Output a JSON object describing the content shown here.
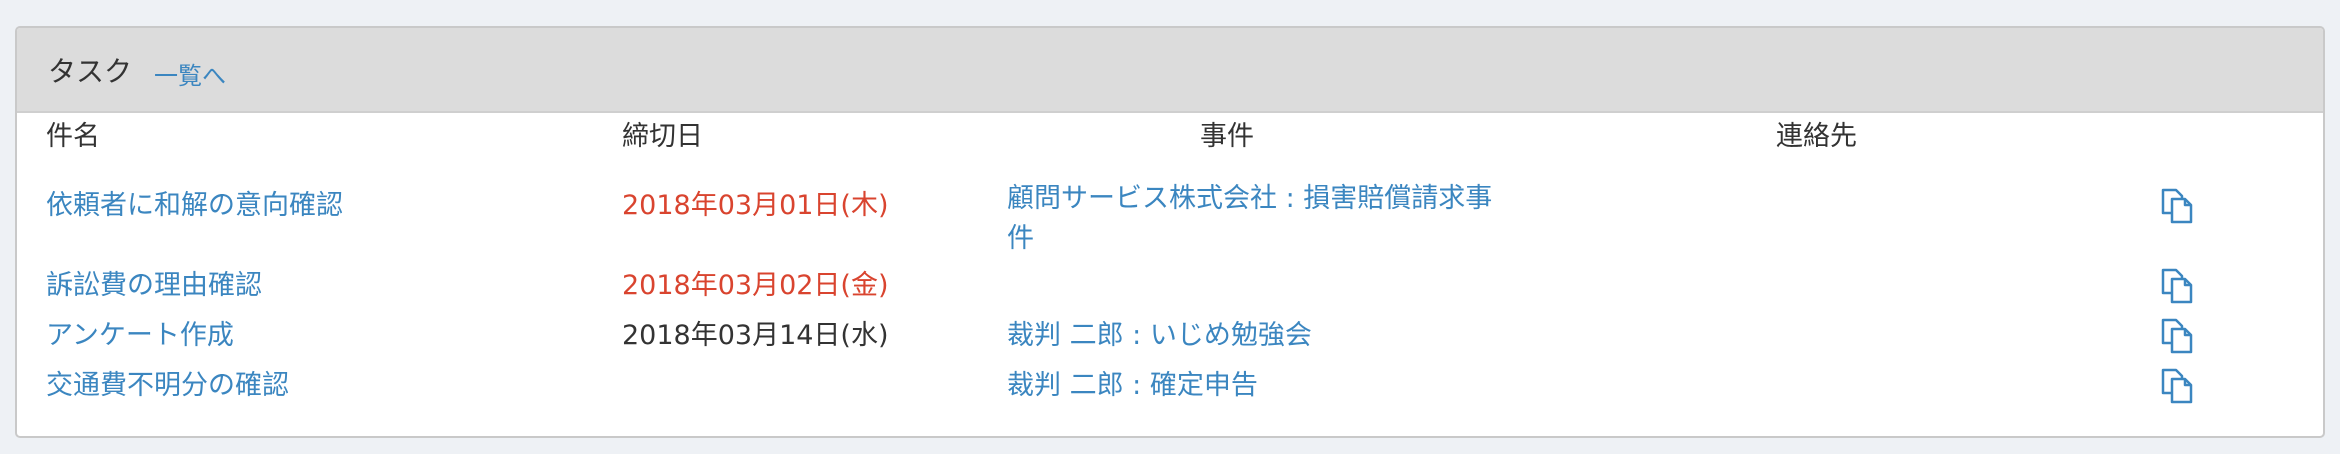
{
  "panel": {
    "title": "タスク",
    "list_link": "一覧へ"
  },
  "table": {
    "headers": {
      "name": "件名",
      "deadline": "締切日",
      "case": "事件",
      "contact": "連絡先"
    },
    "rows": [
      {
        "name": "依頼者に和解の意向確認",
        "deadline": "2018年03月01日(木)",
        "deadline_overdue": true,
        "case": "顧問サービス株式会社 : 損害賠償請求事件",
        "contact": ""
      },
      {
        "name": "訴訟費の理由確認",
        "deadline": "2018年03月02日(金)",
        "deadline_overdue": true,
        "case": "",
        "contact": ""
      },
      {
        "name": "アンケート作成",
        "deadline": "2018年03月14日(水)",
        "deadline_overdue": false,
        "case": "裁判 二郎 : いじめ勉強会",
        "contact": ""
      },
      {
        "name": "交通費不明分の確認",
        "deadline": "",
        "deadline_overdue": false,
        "case": "裁判 二郎 : 確定申告",
        "contact": ""
      }
    ]
  },
  "colors": {
    "link": "#3b86c0",
    "overdue": "#d9442f",
    "header_bg": "#dcdcdc"
  },
  "icons": {
    "row_action": "copy-icon"
  }
}
